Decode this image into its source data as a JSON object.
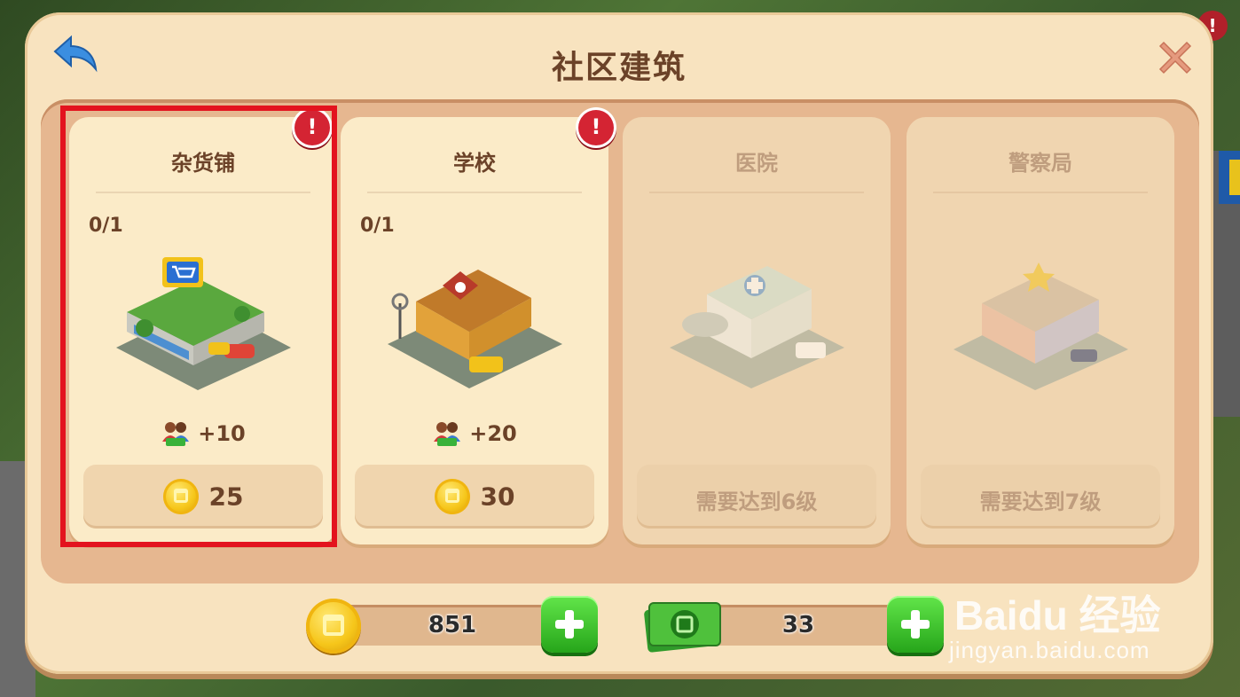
{
  "dialog": {
    "title": "社区建筑",
    "corner_alert": "!"
  },
  "cards": [
    {
      "title": "杂货铺",
      "count": "0/1",
      "population": "+10",
      "price": "25",
      "alert": "!",
      "locked": false
    },
    {
      "title": "学校",
      "count": "0/1",
      "population": "+20",
      "price": "30",
      "alert": "!",
      "locked": false
    },
    {
      "title": "医院",
      "requirement": "需要达到6级",
      "locked": true
    },
    {
      "title": "警察局",
      "requirement": "需要达到7级",
      "locked": true
    }
  ],
  "currency": {
    "coins": "851",
    "cash": "33"
  },
  "watermark": {
    "brand": "Baidu 经验",
    "url": "jingyan.baidu.com"
  },
  "colors": {
    "panel": "#f8e3bf",
    "title_text": "#6b4228",
    "highlight": "#e3131e",
    "badge": "#d42433",
    "plus_button": "#26a51a"
  }
}
